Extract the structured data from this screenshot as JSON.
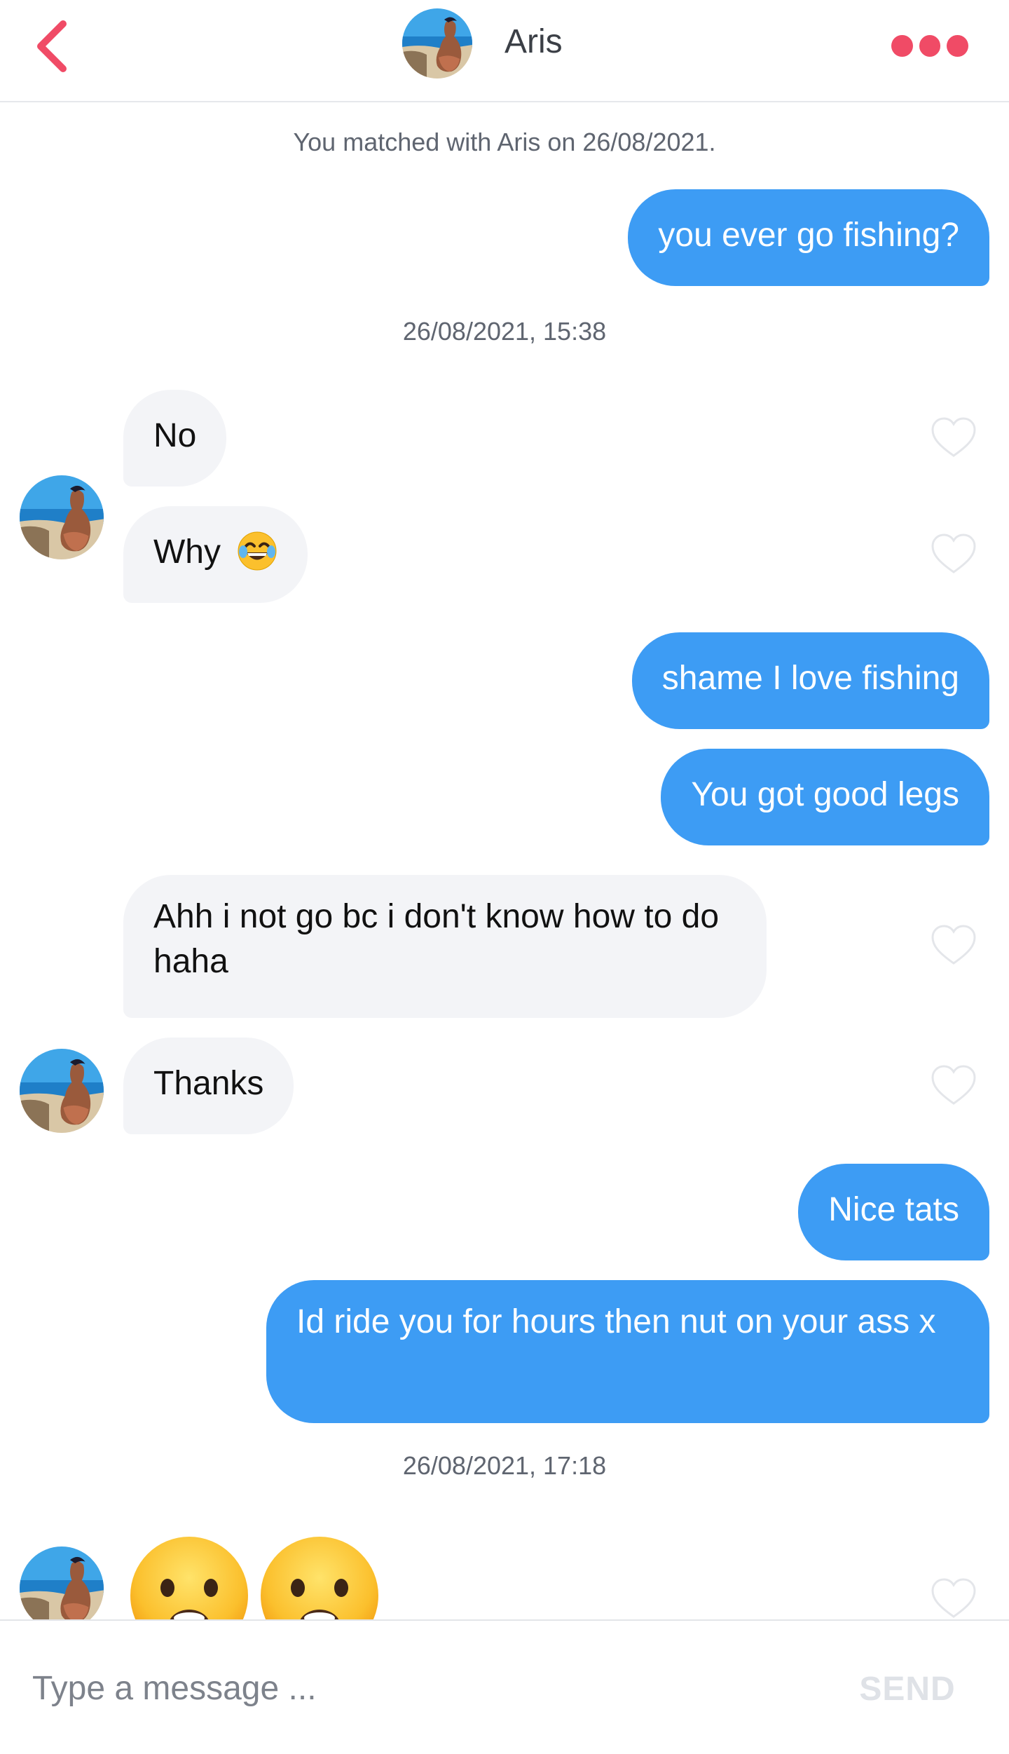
{
  "header": {
    "back_icon": "chevron-left-icon",
    "name": "Aris",
    "more_icon": "more-dots-icon",
    "accent": "#f04b66"
  },
  "system": {
    "matched": "You matched with Aris on 26/08/2021.",
    "stamp1": "26/08/2021, 15:38",
    "stamp2": "26/08/2021, 17:18"
  },
  "messages": {
    "m1": "you ever go fishing?",
    "m2": "No",
    "m3": "Why",
    "m4": "shame I love fishing",
    "m5": "You got good legs",
    "m6": "Ahh i not go bc i don't know how to do haha",
    "m7": "Thanks",
    "m8": "Nice tats",
    "m9": "Id ride you for hours then nut on your ass x"
  },
  "composer": {
    "placeholder": "Type a message ...",
    "send_label": "SEND"
  },
  "colors": {
    "outgoing": "#3d9cf4",
    "incoming": "#f3f4f7"
  }
}
